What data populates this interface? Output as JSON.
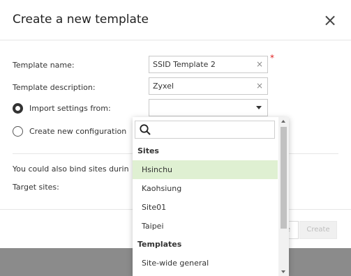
{
  "dialog": {
    "title": "Create a new template",
    "close_glyph": "×"
  },
  "form": {
    "template_name_label": "Template name:",
    "template_name_value": "SSID Template 2",
    "template_description_label": "Template description:",
    "template_description_value": "Zyxel",
    "import_label": "Import settings from:",
    "import_value": "",
    "create_new_label": "Create new configuration",
    "bind_info_text": "You could also bind sites durin",
    "target_sites_label": "Target sites:",
    "required_marker": "*",
    "clear_glyph": "×"
  },
  "footer": {
    "cancel_label_partial": "e",
    "create_label": "Create"
  },
  "dropdown": {
    "search_value": "",
    "groups": [
      {
        "label": "Sites",
        "options": [
          "Hsinchu",
          "Kaohsiung",
          "Site01",
          "Taipei"
        ]
      },
      {
        "label": "Templates",
        "options": [
          "Site-wide general"
        ]
      }
    ],
    "highlighted_option": "Hsinchu"
  },
  "colors": {
    "highlight": "#dff0d2",
    "required": "#e02020",
    "backdrop": "#8b8b8b"
  }
}
